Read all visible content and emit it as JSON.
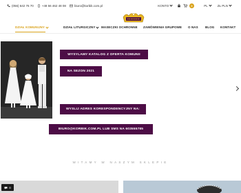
{
  "topbar": {
    "phone1": "(056) 642 76 70",
    "phone2": "+48 56 462 48 08",
    "email": "biuro@korbik.com.pl",
    "contact_label": "KONTO",
    "cart_count": "0",
    "lang_label": "PL",
    "currency_label": "ZŁ PLN"
  },
  "nav": {
    "items": [
      {
        "label": "DZIAŁ KOMUNIJNY"
      },
      {
        "label": "DZIAŁ LITURGICZNY"
      },
      {
        "label": "MASECZKI OCHRONNE"
      },
      {
        "label": "ZAMÓWIENIA GRUPOWE"
      },
      {
        "label": "O NAS"
      },
      {
        "label": "BLOG"
      },
      {
        "label": "KONTAKT"
      }
    ]
  },
  "hero": {
    "line1": "WYSYLAMY KATALOG Z OFERTA KOMUNII",
    "line2": "NA SEZON 2021",
    "line3": "WYSLIJ ADRES KORESPONDENCYJNY NA:",
    "line4": "BIURO@KORBIK.COM.PL LUB SMS NA 603555785"
  },
  "welcome": "WITAMY W NASZYM SKLEPIE",
  "chat": {
    "count": "0"
  },
  "colors": {
    "accent": "#d9a21b",
    "banner": "#4d0d46"
  }
}
